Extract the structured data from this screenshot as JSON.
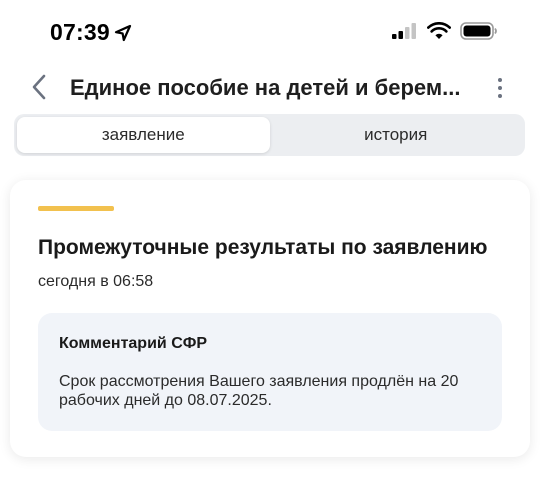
{
  "status_bar": {
    "time": "07:39",
    "icons": [
      "location-arrow-icon",
      "cellular-signal-icon",
      "wifi-icon",
      "battery-icon"
    ]
  },
  "header": {
    "title": "Единое пособие на детей и берем...",
    "icons": [
      "back-chevron-icon",
      "more-vertical-icon"
    ]
  },
  "tabs": [
    {
      "label": "заявление",
      "active": true
    },
    {
      "label": "история",
      "active": false
    }
  ],
  "card": {
    "title": "Промежуточные результаты по заявлению",
    "time": "сегодня в 06:58",
    "comment": {
      "heading": "Комментарий СФР",
      "text": "Срок рассмотрения Вашего заявления продлён на 20 рабочих дней до 08.07.2025."
    }
  },
  "colors": {
    "accent": "#f2c14e",
    "tab_background": "#eceef1",
    "comment_background": "#f1f4f9"
  }
}
